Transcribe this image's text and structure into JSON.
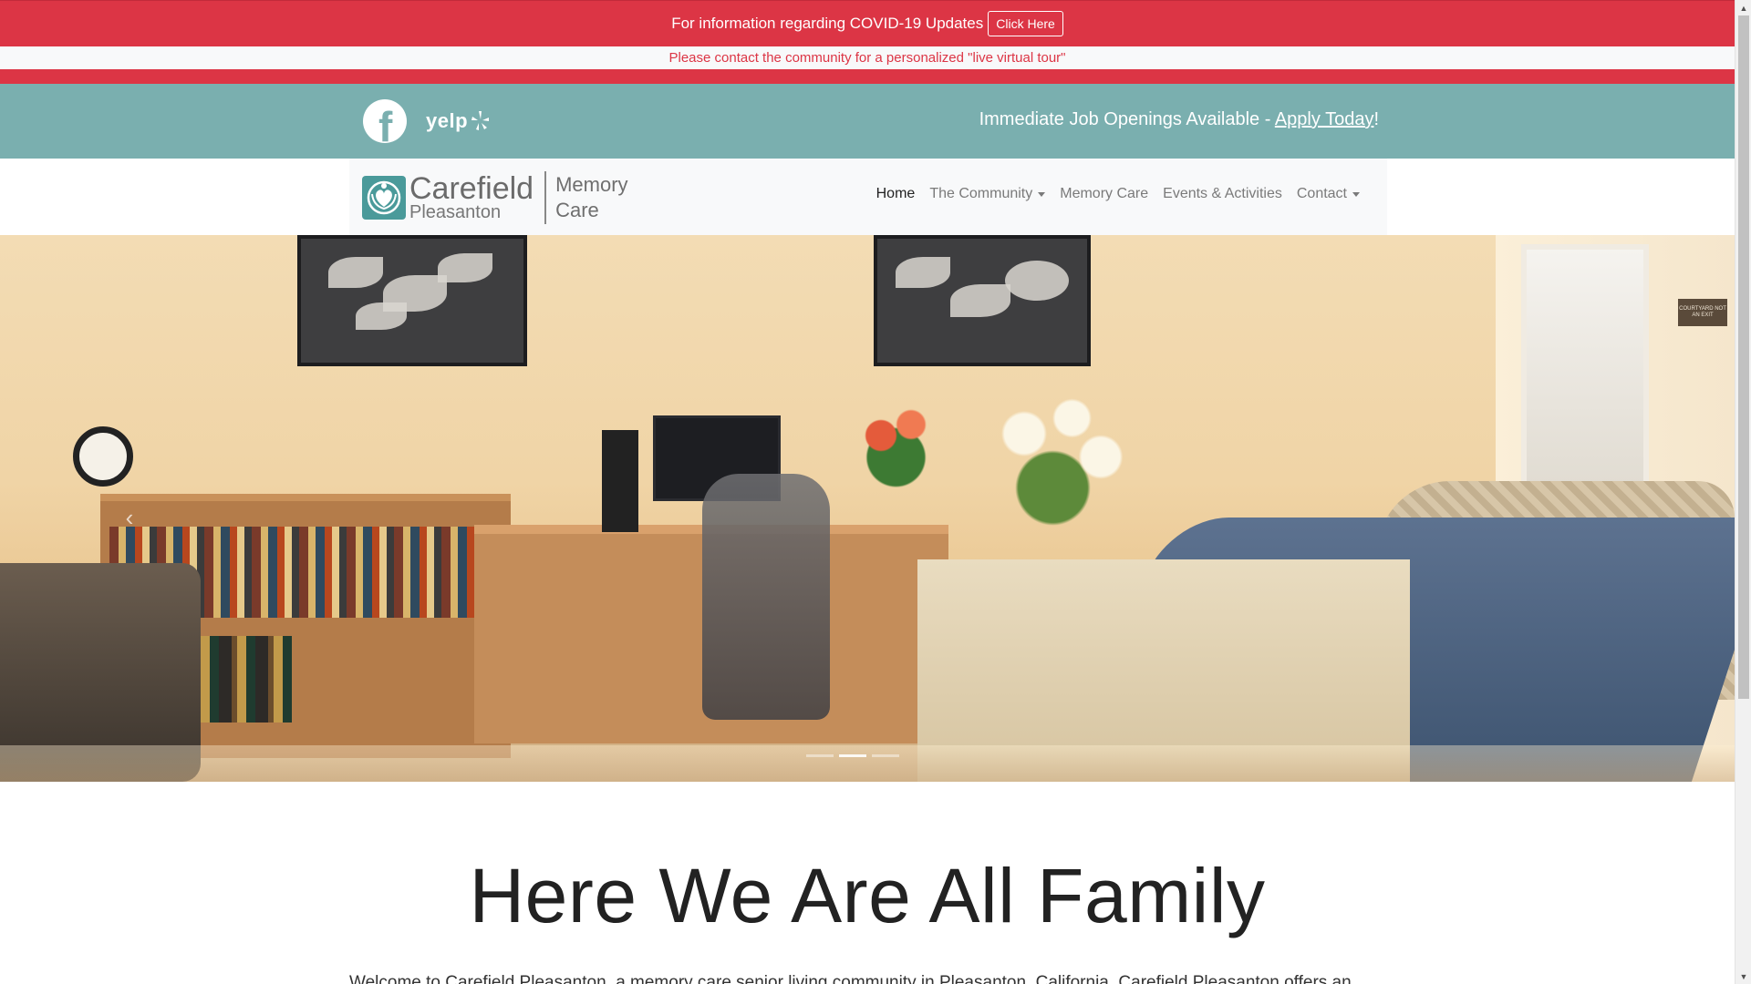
{
  "covid": {
    "text": "For information regarding COVID-19 Updates",
    "button_label": "Click Here",
    "virtual_tour": "Please contact the community for a personalized \"live virtual tour\""
  },
  "social": {
    "facebook_glyph": "f",
    "yelp_label": "yelp",
    "jobs_prefix": "Immediate Job Openings Available - ",
    "jobs_link": "Apply Today",
    "jobs_suffix": "!"
  },
  "logo": {
    "brand": "Carefield",
    "location": "Pleasanton",
    "tagline_line1": "Memory",
    "tagline_line2": "Care"
  },
  "nav": {
    "items": [
      {
        "label": "Home",
        "active": true,
        "dropdown": false
      },
      {
        "label": "The Community",
        "active": false,
        "dropdown": true
      },
      {
        "label": "Memory Care",
        "active": false,
        "dropdown": false
      },
      {
        "label": "Events & Activities",
        "active": false,
        "dropdown": false
      },
      {
        "label": "Contact",
        "active": false,
        "dropdown": true
      }
    ]
  },
  "hero": {
    "sign_text": "COURTYARD NOT AN EXIT",
    "prev_glyph": "‹"
  },
  "main": {
    "title": "Here We Are All Family",
    "intro": "Welcome to Carefield Pleasanton, a memory care senior living community in Pleasanton, California. Carefield Pleasanton offers an"
  },
  "colors": {
    "alert_red": "#dc3545",
    "teal": "#7aafaf",
    "logo_teal": "#4a9a9a"
  },
  "icons": {
    "facebook": "facebook-icon",
    "yelp": "yelp-icon",
    "logo": "carefield-logo-icon",
    "dropdown": "caret-down-icon"
  }
}
